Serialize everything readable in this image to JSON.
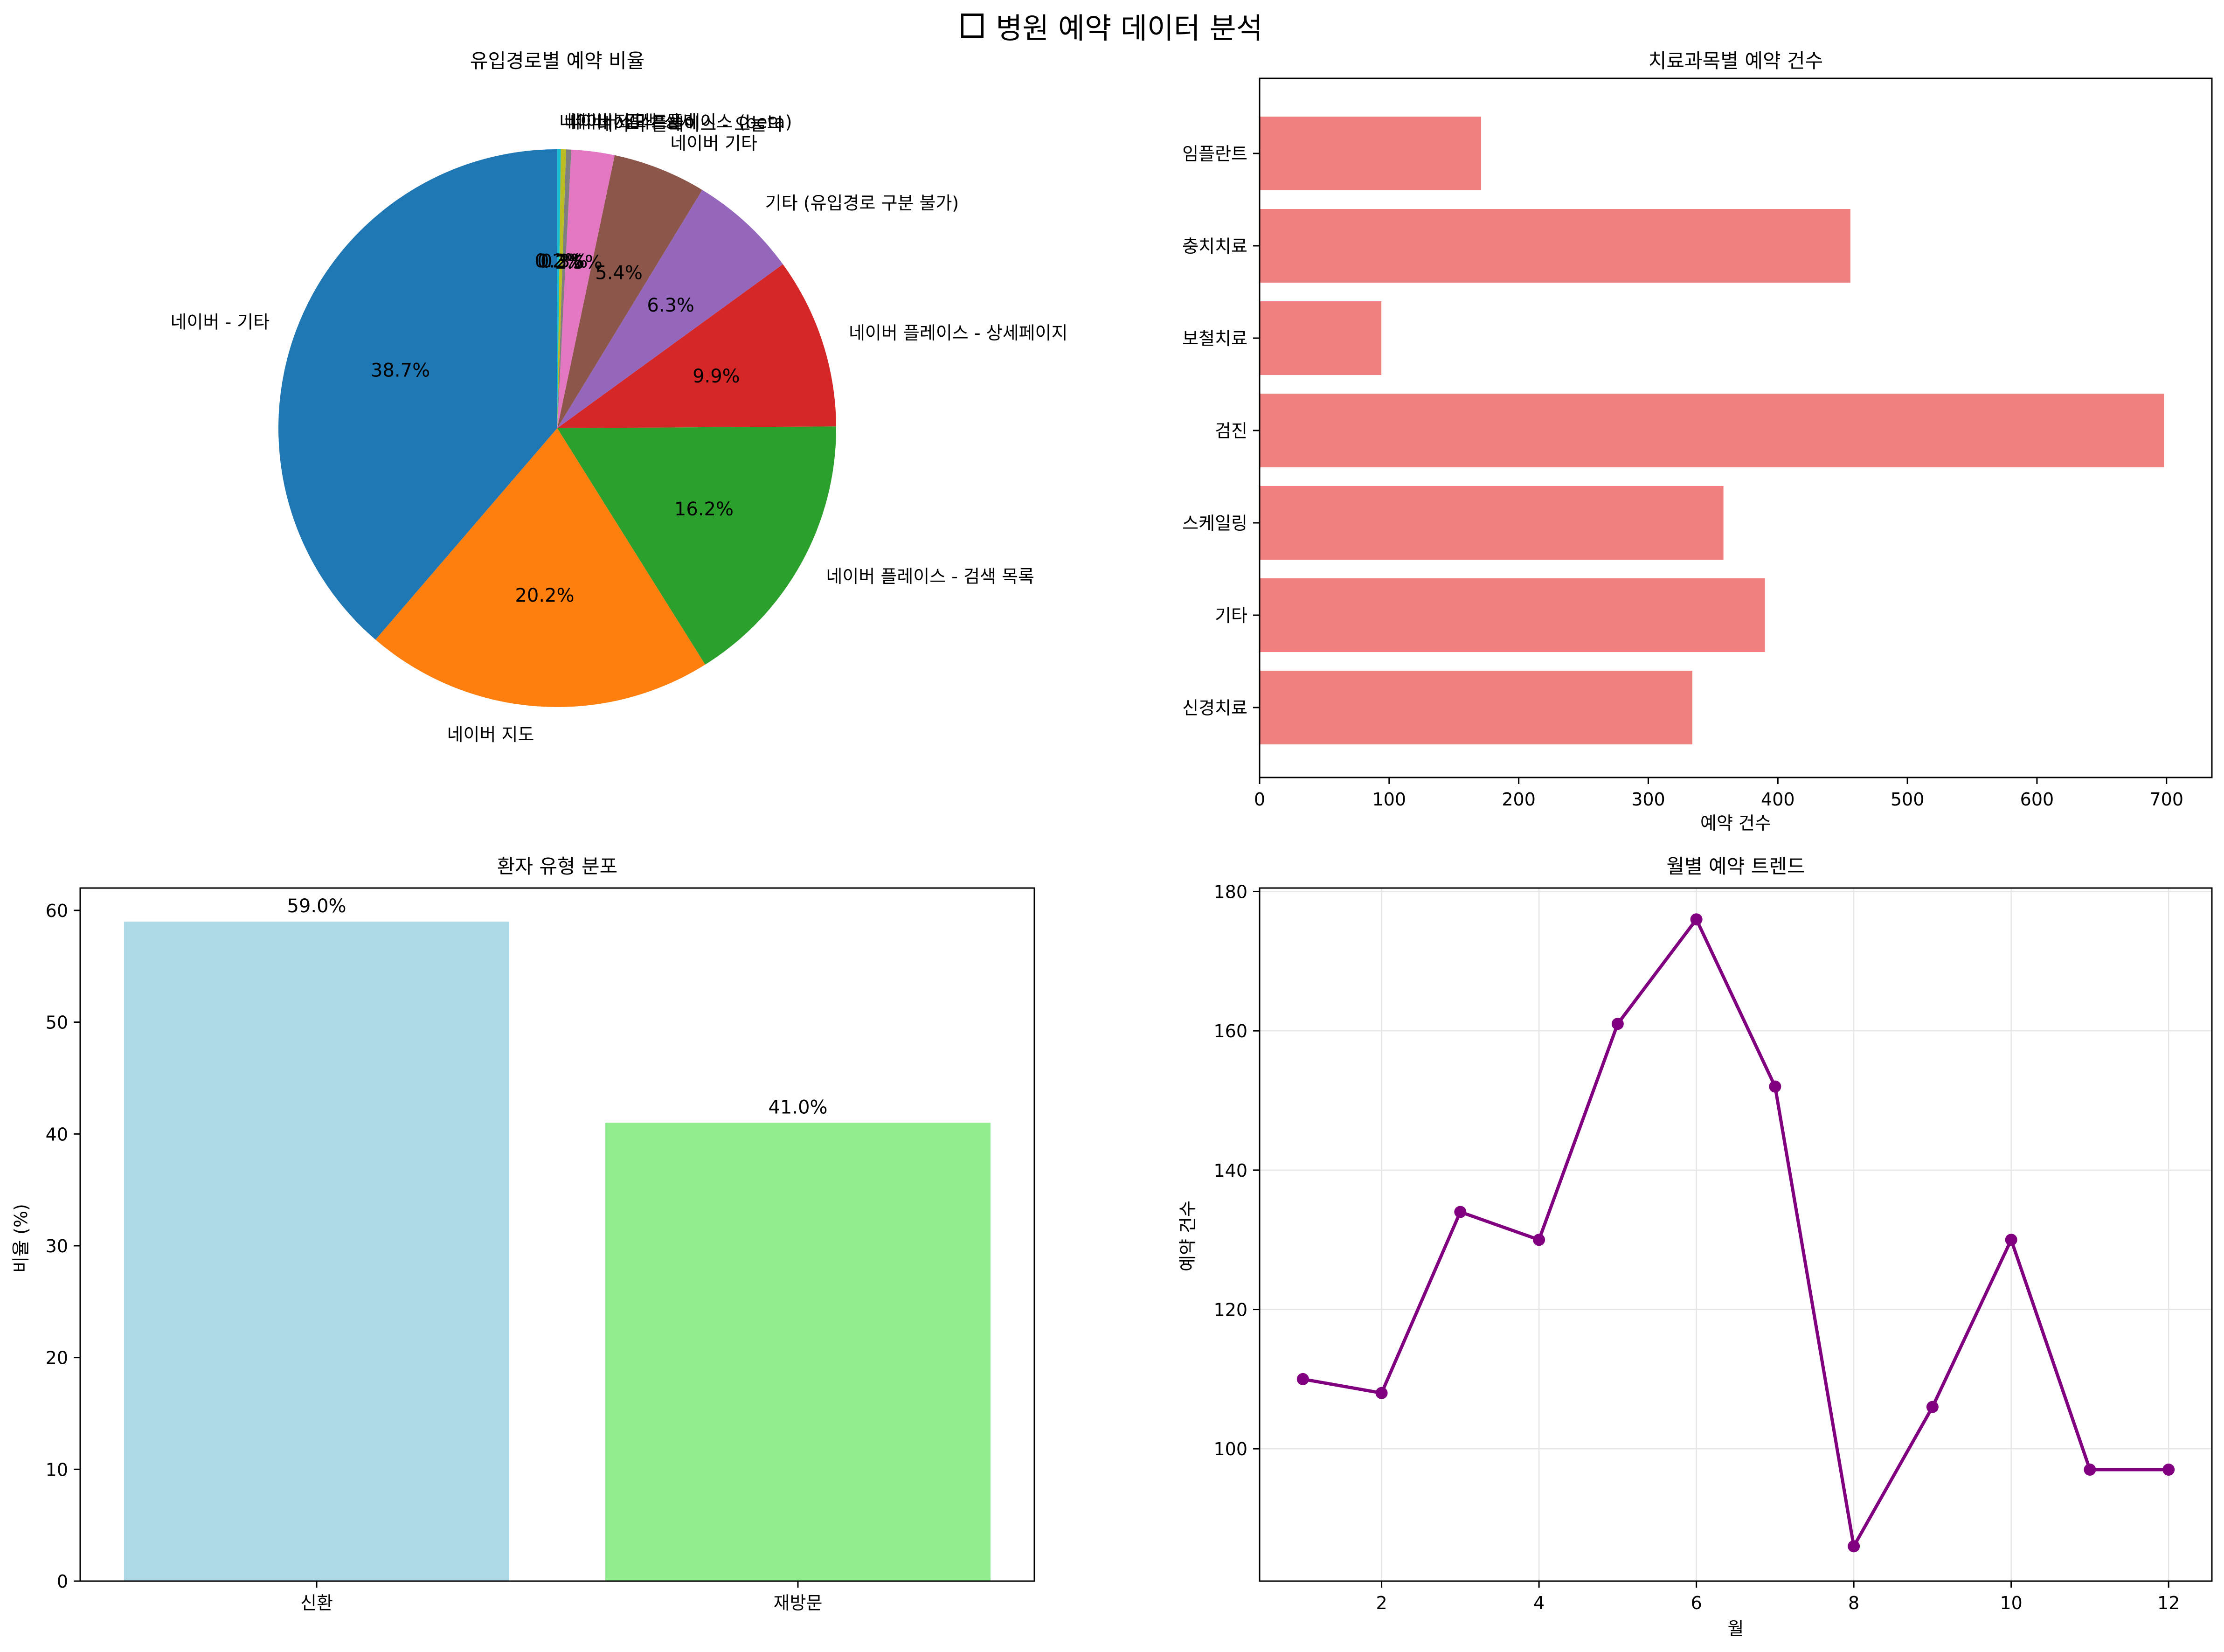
{
  "figure": {
    "title": "병원 예약 데이터 분석",
    "title_icon": "missing-glyph-box"
  },
  "chart_data": [
    {
      "type": "pie",
      "title": "유입경로별 예약 비율",
      "start_angle_deg": 90,
      "direction": "counterclockwise",
      "slices": [
        {
          "label": "네이버 - 기타",
          "value": 38.7,
          "pct_label": "38.7%",
          "color": "#1f77b4"
        },
        {
          "label": "네이버 지도",
          "value": 20.2,
          "pct_label": "20.2%",
          "color": "#ff7f0e"
        },
        {
          "label": "네이버 플레이스 - 검색 목록",
          "value": 16.2,
          "pct_label": "16.2%",
          "color": "#2ca02c"
        },
        {
          "label": "네이버 플레이스 - 상세페이지",
          "value": 9.9,
          "pct_label": "9.9%",
          "color": "#d62728"
        },
        {
          "label": "기타 (유입경로 구분 불가)",
          "value": 6.3,
          "pct_label": "6.3%",
          "color": "#9467bd"
        },
        {
          "label": "네이버 기타",
          "value": 5.4,
          "pct_label": "5.4%",
          "color": "#8c564b"
        },
        {
          "label": "네이버 플레이스 - 오늘의",
          "value": 2.5,
          "pct_label": "2.5%",
          "color": "#e377c2"
        },
        {
          "label": "네이버 검색",
          "value": 0.3,
          "pct_label": "0.3%",
          "color": "#7f7f7f"
        },
        {
          "label": "네이버 스마트플레이스 (beta)",
          "value": 0.3,
          "pct_label": "0.3%",
          "color": "#bcbd22"
        },
        {
          "label": "네이버 지도 - 상세",
          "value": 0.2,
          "pct_label": "0.2%",
          "color": "#17becf"
        }
      ]
    },
    {
      "type": "bar",
      "orientation": "horizontal",
      "title": "치료과목별 예약 건수",
      "xlabel": "예약 건수",
      "ylabel": "",
      "categories": [
        "신경치료",
        "기타",
        "스케일링",
        "검진",
        "보철치료",
        "충치치료",
        "임플란트"
      ],
      "values": [
        334,
        390,
        358,
        698,
        94,
        456,
        171
      ],
      "xlim": [
        0,
        735
      ],
      "xticks": [
        0,
        100,
        200,
        300,
        400,
        500,
        600,
        700
      ],
      "color": "#f08080"
    },
    {
      "type": "bar",
      "title": "환자 유형 분포",
      "xlabel": "",
      "ylabel": "비율 (%)",
      "categories": [
        "신환",
        "재방문"
      ],
      "values": [
        59.0,
        41.0
      ],
      "value_labels": [
        "59.0%",
        "41.0%"
      ],
      "colors": [
        "#add8e6",
        "#90ee90"
      ],
      "ylim": [
        0,
        62
      ],
      "yticks": [
        0,
        10,
        20,
        30,
        40,
        50,
        60
      ]
    },
    {
      "type": "line",
      "title": "월별 예약 트렌드",
      "xlabel": "월",
      "ylabel": "예약 건수",
      "x": [
        1,
        2,
        3,
        4,
        5,
        6,
        7,
        8,
        9,
        10,
        11,
        12
      ],
      "y": [
        110,
        108,
        134,
        130,
        161,
        176,
        152,
        86,
        106,
        130,
        97,
        97
      ],
      "xlim": [
        0.45,
        12.55
      ],
      "ylim": [
        81,
        180.5
      ],
      "xticks": [
        2,
        4,
        6,
        8,
        10,
        12
      ],
      "yticks": [
        100,
        120,
        140,
        160,
        180
      ],
      "grid": true,
      "color": "#800080"
    }
  ]
}
